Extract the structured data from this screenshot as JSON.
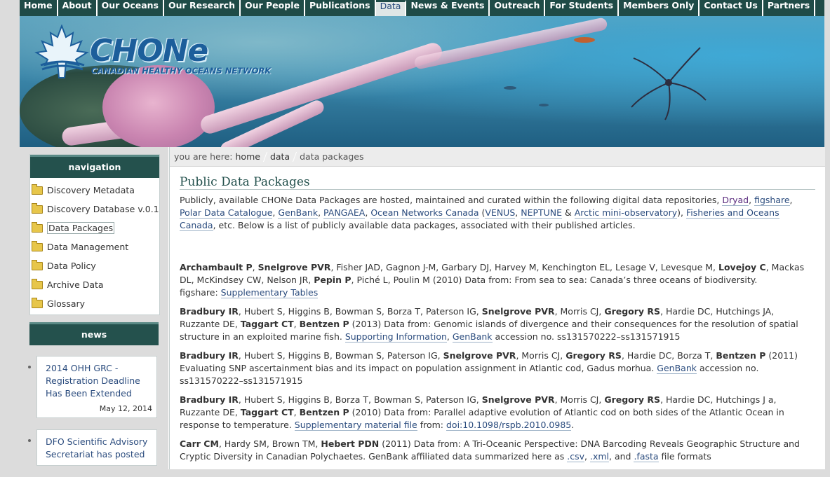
{
  "topnav": {
    "items": [
      {
        "label": "Home",
        "active": false
      },
      {
        "label": "About",
        "active": false
      },
      {
        "label": "Our Oceans",
        "active": false
      },
      {
        "label": "Our Research",
        "active": false
      },
      {
        "label": "Our People",
        "active": false
      },
      {
        "label": "Publications",
        "active": false
      },
      {
        "label": "Data",
        "active": true
      },
      {
        "label": "News & Events",
        "active": false
      },
      {
        "label": "Outreach",
        "active": false
      },
      {
        "label": "For Students",
        "active": false
      },
      {
        "label": "Members Only",
        "active": false
      },
      {
        "label": "Contact Us",
        "active": false
      },
      {
        "label": "Partners",
        "active": false
      }
    ]
  },
  "banner": {
    "logo_text": "CHONe",
    "logo_subtitle": "CANADIAN HEALTHY OCEANS NETWORK"
  },
  "sidebar": {
    "nav_title": "navigation",
    "items": [
      {
        "label": "Discovery Metadata"
      },
      {
        "label": "Discovery Database v.0.1"
      },
      {
        "label": "Data Packages"
      },
      {
        "label": "Data Management"
      },
      {
        "label": "Data Policy"
      },
      {
        "label": "Archive Data"
      },
      {
        "label": "Glossary"
      }
    ],
    "news_title": "news",
    "news": [
      {
        "title": "2014 OHH GRC - Registration Deadline Has Been Extended",
        "date": "May 12, 2014"
      },
      {
        "title": "DFO Scientific Advisory Secretariat has posted",
        "date": ""
      }
    ]
  },
  "breadcrumb": {
    "prefix": "you are here:",
    "items": [
      "home",
      "data",
      "data packages"
    ]
  },
  "main": {
    "title": "Public Data Packages",
    "intro": {
      "t1": "Publicly, available CHONe Data Packages are hosted, maintained and curated within the following digital data repositories, ",
      "dryad": "Dryad",
      "figshare": "figshare",
      "polar": "Polar Data Catalogue",
      "genbank": "GenBank",
      "pangaea": "PANGAEA",
      "onc": "Ocean Networks Canada",
      "venus": "VENUS",
      "neptune": "NEPTUNE",
      "arctic": "Arctic mini-observatory",
      "dfo": "Fisheries and Oceans Canada",
      "t2": ", etc. Below is a list of publicly available data packages, associated with their published articles."
    },
    "entries": {
      "e1": {
        "a1": "Archambault P",
        "a2": "Snelgrove PVR",
        "t1": ", Fisher JAD, Gagnon J-M, Garbary DJ, Harvey M, Kenchington EL, Lesage V, Levesque M, ",
        "a3": "Lovejoy C",
        "t2": ", Mackas DL, McKindsey CW, Nelson JR, ",
        "a4": "Pepin P",
        "t3": ", Piché L, Poulin M (2010) Data from: From sea to sea: Canada’s three oceans of biodiversity.",
        "repo": "figshare: ",
        "link1": "Supplementary Tables"
      },
      "e2": {
        "a1": "Bradbury IR",
        "t1": ", Hubert S, Higgins B, Bowman S, Borza T, Paterson IG, ",
        "a2": "Snelgrove PVR",
        "t2": ", Morris CJ, ",
        "a3": "Gregory RS",
        "t3": ", Hardie DC, Hutchings JA, Ruzzante DE, ",
        "a4": "Taggart CT",
        "a5": "Bentzen P",
        "t4": " (2013) Data from: Genomic islands of divergence and their consequences for the resolution of spatial structure in an exploited marine fish. ",
        "link1": "Supporting Information",
        "link2": "GenBank",
        "t5": "  accession no. ss131570222–ss131571915"
      },
      "e3": {
        "a1": "Bradbury IR",
        "t1": ", Hubert S, Higgins B, Bowman S, Paterson IG, ",
        "a2": "Snelgrove PVR",
        "t2": ", Morris CJ, ",
        "a3": "Gregory RS",
        "t3": ", Hardie DC, Borza T, ",
        "a4": "Bentzen P",
        "t4": " (2011) Evaluating SNP ascertainment bias and its impact on population assignment in Atlantic cod, Gadus morhua. ",
        "link1": "GenBank",
        "t5": " accession no. ss131570222–ss131571915"
      },
      "e4": {
        "a1": "Bradbury IR",
        "t1": ", Hubert S, Higgins B, Borza T, Bowman S, Paterson IG, ",
        "a2": "Snelgrove PVR",
        "t2": ", Morris CJ, ",
        "a3": "Gregory RS",
        "t3": ", Hardie DC, Hutchings J a, Ruzzante DE, ",
        "a4": "Taggart CT",
        "a5": "Bentzen P",
        "t4": " (2010) Data from: Parallel adaptive evolution of Atlantic cod on both sides of the Atlantic Ocean in response to temperature. ",
        "link1": "Supplementary material file",
        "t5": " from: ",
        "link2": "doi:10.1098/rspb.2010.0985",
        "t6": "."
      },
      "e5": {
        "a1": "Carr CM",
        "t1": ", Hardy SM, Brown TM, ",
        "a2": "Hebert PDN",
        "t2": " (2011) Data from: A Tri-Oceanic Perspective: DNA Barcoding Reveals Geographic Structure and Cryptic Diversity in Canadian Polychaetes. GenBank affiliated data summarized here as ",
        "link1": ".csv",
        "link2": ".xml",
        "t3": ", and ",
        "link3": ".fasta",
        "t4": " file formats"
      }
    }
  }
}
